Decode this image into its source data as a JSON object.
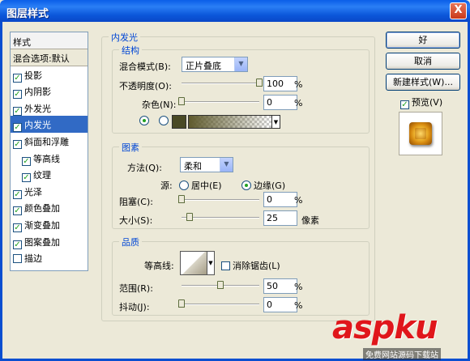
{
  "window": {
    "title": "图层样式",
    "close_glyph": "X"
  },
  "left_panel": {
    "header": "样式",
    "items": [
      {
        "label": "混合选项:默认",
        "checked": null,
        "indent": false,
        "selected": false
      },
      {
        "label": "投影",
        "checked": true,
        "indent": false,
        "selected": false
      },
      {
        "label": "内阴影",
        "checked": true,
        "indent": false,
        "selected": false
      },
      {
        "label": "外发光",
        "checked": true,
        "indent": false,
        "selected": false
      },
      {
        "label": "内发光",
        "checked": true,
        "indent": false,
        "selected": true
      },
      {
        "label": "斜面和浮雕",
        "checked": true,
        "indent": false,
        "selected": false
      },
      {
        "label": "等高线",
        "checked": true,
        "indent": true,
        "selected": false
      },
      {
        "label": "纹理",
        "checked": true,
        "indent": true,
        "selected": false
      },
      {
        "label": "光泽",
        "checked": true,
        "indent": false,
        "selected": false
      },
      {
        "label": "颜色叠加",
        "checked": true,
        "indent": false,
        "selected": false
      },
      {
        "label": "渐变叠加",
        "checked": true,
        "indent": false,
        "selected": false
      },
      {
        "label": "图案叠加",
        "checked": true,
        "indent": false,
        "selected": false
      },
      {
        "label": "描边",
        "checked": false,
        "indent": false,
        "selected": false
      }
    ]
  },
  "inner_glow": {
    "title": "内发光",
    "structure": {
      "title": "结构",
      "blend_mode_label": "混合模式(B):",
      "blend_mode_value": "正片叠底",
      "opacity_label": "不透明度(O):",
      "opacity_value": "100",
      "opacity_unit": "%",
      "opacity_level": 1.0,
      "noise_label": "杂色(N):",
      "noise_value": "0",
      "noise_unit": "%",
      "noise_level": 0.0,
      "color_swatch": "#4a4a25"
    },
    "elements": {
      "title": "图素",
      "technique_label": "方法(Q):",
      "technique_value": "柔和",
      "source_label": "源:",
      "source_center": "居中(E)",
      "source_edge": "边缘(G)",
      "choke_label": "阻塞(C):",
      "choke_value": "0",
      "choke_unit": "%",
      "choke_level": 0.0,
      "size_label": "大小(S):",
      "size_value": "25",
      "size_unit": "像素",
      "size_level": 0.1
    },
    "quality": {
      "title": "品质",
      "contour_label": "等高线:",
      "antialias_label": "消除锯齿(L)",
      "range_label": "范围(R):",
      "range_value": "50",
      "range_unit": "%",
      "range_level": 0.5,
      "jitter_label": "抖动(J):",
      "jitter_value": "0",
      "jitter_unit": "%",
      "jitter_level": 0.0
    }
  },
  "buttons": {
    "ok": "好",
    "cancel": "取消",
    "new_style": "新建样式(W)...",
    "preview_label": "预览(V)"
  },
  "watermark": {
    "logo": "aspku",
    "sub": "免费网站源码下载站"
  },
  "colors": {
    "accent": "#0046d5",
    "selection": "#316ac5",
    "title_bar": "#0a5ee8"
  }
}
